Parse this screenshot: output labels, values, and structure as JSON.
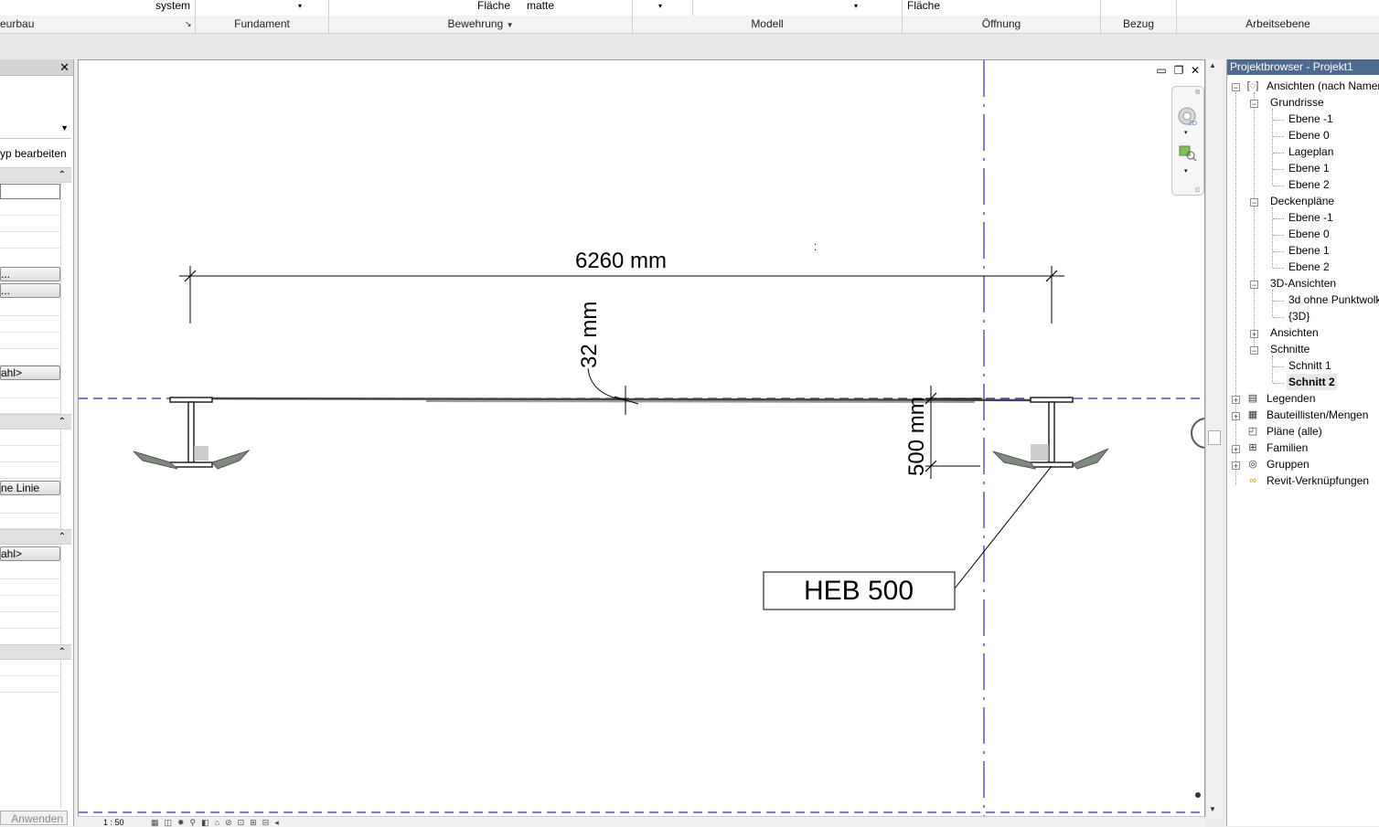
{
  "ribbon": {
    "top_fields": {
      "system": "system",
      "flaeche_label": "Fläche",
      "matte": "matte",
      "flaeche_right": "Fläche"
    },
    "panels": {
      "ingenieurbau": "eurbau",
      "fundament": "Fundament",
      "bewehrung": "Bewehrung",
      "modell": "Modell",
      "oeffnung": "Öffnung",
      "bezug": "Bezug",
      "arbeitsebene": "Arbeitsebene"
    }
  },
  "properties": {
    "close": "✕",
    "edit_type": "yp bearbeiten",
    "buttons": [
      "...",
      "...",
      "ahl>",
      "ne Linie",
      "ahl>"
    ],
    "apply": "Anwenden"
  },
  "drawing": {
    "dim_width": "6260 mm",
    "dim_small": "32 mm",
    "dim_height": "500 mm",
    "tag": "HEB 500",
    "scale": "1 : 50"
  },
  "browser": {
    "title": "Projektbrowser - Projekt1",
    "root": "Ansichten (nach Namen",
    "grundrisse": {
      "label": "Grundrisse",
      "items": [
        "Ebene -1",
        "Ebene 0",
        "Lageplan",
        "Ebene 1",
        "Ebene 2"
      ]
    },
    "deckenplaene": {
      "label": "Deckenpläne",
      "items": [
        "Ebene -1",
        "Ebene 0",
        "Ebene 1",
        "Ebene 2"
      ]
    },
    "ansichten3d": {
      "label": "3D-Ansichten",
      "items": [
        "3d ohne Punktwolk",
        "{3D}"
      ]
    },
    "ansichten": "Ansichten",
    "schnitte": {
      "label": "Schnitte",
      "items": [
        "Schnitt 1",
        "Schnitt 2"
      ]
    },
    "legenden": "Legenden",
    "bauteillisten": "Bauteillisten/Mengen",
    "plaene": "Pläne (alle)",
    "familien": "Familien",
    "gruppen": "Gruppen",
    "revit": "Revit-Verknüpfungen"
  },
  "colors": {
    "accent_title": "#4e6b8f",
    "section_line": "#2a2aa8",
    "dim_line": "#000000"
  }
}
